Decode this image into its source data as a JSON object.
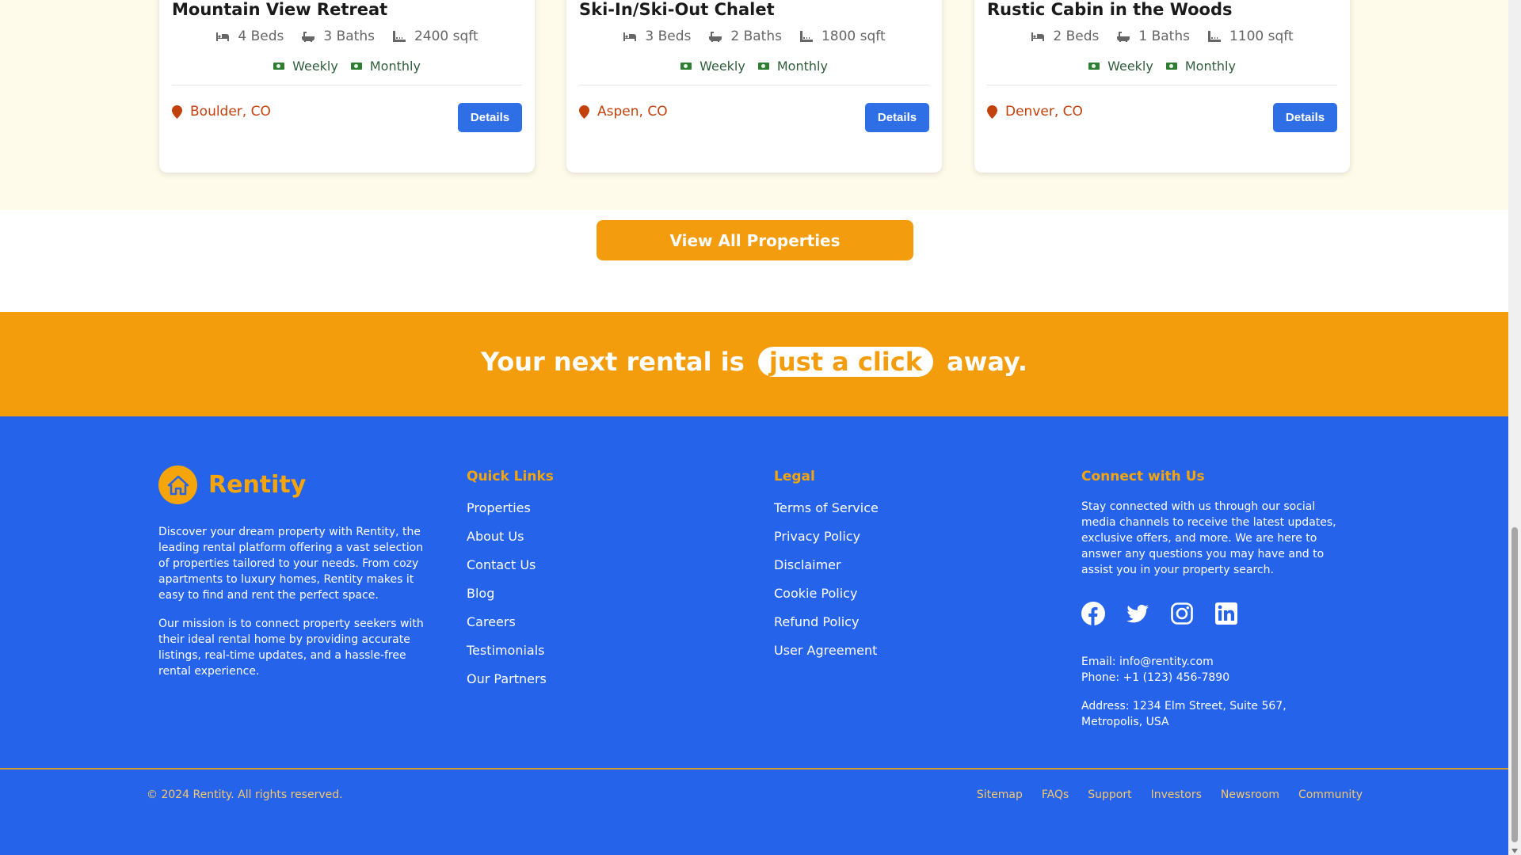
{
  "cards": [
    {
      "title": "Mountain View Retreat",
      "beds": "4 Beds",
      "baths": "3 Baths",
      "area": "2400 sqft",
      "weekly": "Weekly",
      "monthly": "Monthly",
      "location": "Boulder, CO",
      "button": "Details"
    },
    {
      "title": "Ski-In/Ski-Out Chalet",
      "beds": "3 Beds",
      "baths": "2 Baths",
      "area": "1800 sqft",
      "weekly": "Weekly",
      "monthly": "Monthly",
      "location": "Aspen, CO",
      "button": "Details"
    },
    {
      "title": "Rustic Cabin in the Woods",
      "beds": "2 Beds",
      "baths": "1 Baths",
      "area": "1100 sqft",
      "weekly": "Weekly",
      "monthly": "Monthly",
      "location": "Denver, CO",
      "button": "Details"
    }
  ],
  "view_all_label": "View All Properties",
  "banner": {
    "before": "Your next rental is",
    "highlight": "just a click",
    "after": "away."
  },
  "footer": {
    "brand": "Rentity",
    "about_1": "Discover your dream property with Rentity, the leading rental platform offering a vast selection of properties tailored to your needs. From cozy apartments to luxury homes, Rentity makes it easy to find and rent the perfect space.",
    "about_2": "Our mission is to connect property seekers with their ideal rental home by providing accurate listings, real-time updates, and a hassle-free rental experience.",
    "quick_links_title": "Quick Links",
    "quick_links": [
      "Properties",
      "About Us",
      "Contact Us",
      "Blog",
      "Careers",
      "Testimonials",
      "Our Partners"
    ],
    "legal_title": "Legal",
    "legal_links": [
      "Terms of Service",
      "Privacy Policy",
      "Disclaimer",
      "Cookie Policy",
      "Refund Policy",
      "User Agreement"
    ],
    "connect_title": "Connect with Us",
    "connect_text": "Stay connected with us through our social media channels to receive the latest updates, exclusive offers, and more. We are here to answer any questions you may have and to assist you in your property search.",
    "social_icons": [
      "facebook-icon",
      "twitter-icon",
      "instagram-icon",
      "linkedin-icon"
    ],
    "email": "Email: info@rentity.com",
    "phone": "Phone: +1 (123) 456-7890",
    "address": "Address: 1234 Elm Street, Suite 567, Metropolis, USA",
    "copyright": "© 2024 Rentity. All rights reserved.",
    "bottom_links": [
      "Sitemap",
      "FAQs",
      "Support",
      "Investors",
      "Newsroom",
      "Community"
    ]
  },
  "colors": {
    "accent_orange": "#f39c0c",
    "footer_blue": "#2563eb",
    "button_blue": "#2f6fe6",
    "location_red": "#c2410c"
  }
}
